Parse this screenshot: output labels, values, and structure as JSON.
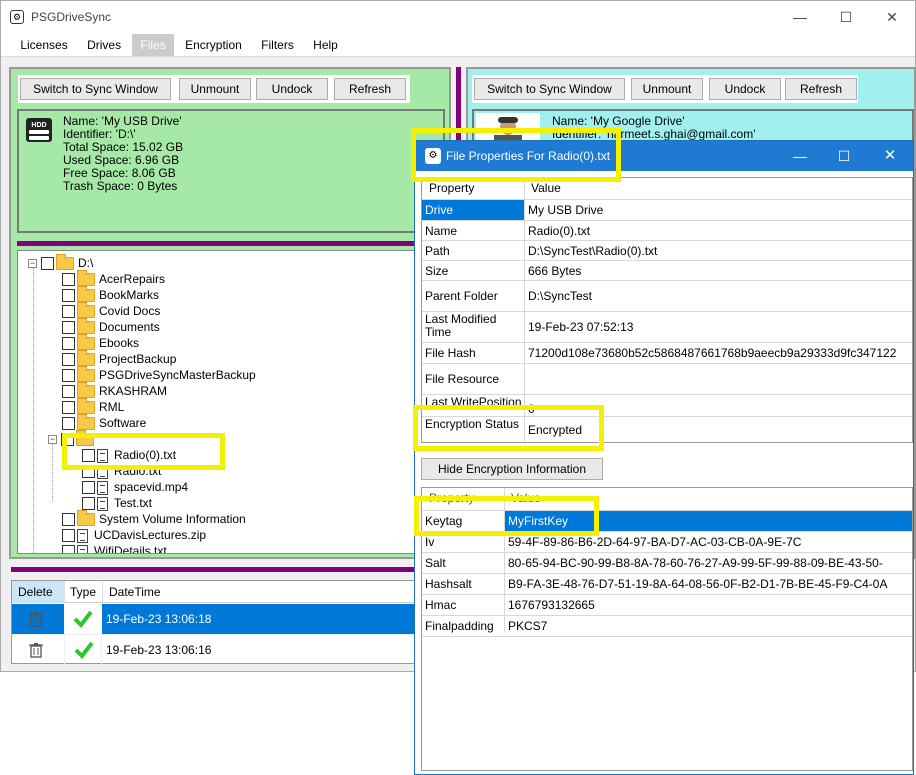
{
  "app": {
    "title": "PSGDriveSync",
    "menu": [
      "Licenses",
      "Drives",
      "Files",
      "Encryption",
      "Filters",
      "Help"
    ],
    "active_menu": "Files"
  },
  "left_panel": {
    "buttons": [
      "Switch to Sync Window",
      "Unmount",
      "Undock",
      "Refresh"
    ],
    "drive_icon_text": "HDD",
    "info": [
      "Name: 'My USB Drive'",
      "Identifier: 'D:\\'",
      "Total Space: 15.02 GB",
      "Used Space: 6.96 GB",
      "Free Space: 8.06 GB",
      "Trash Space: 0 Bytes"
    ],
    "tree": {
      "root": "D:\\",
      "items": [
        {
          "label": "AcerRepairs",
          "type": "folder"
        },
        {
          "label": "BookMarks",
          "type": "folder"
        },
        {
          "label": "Covid Docs",
          "type": "folder"
        },
        {
          "label": "Documents",
          "type": "folder"
        },
        {
          "label": "Ebooks",
          "type": "folder"
        },
        {
          "label": "ProjectBackup",
          "type": "folder"
        },
        {
          "label": "PSGDriveSyncMasterBackup",
          "type": "folder"
        },
        {
          "label": "RKASHRAM",
          "type": "folder"
        },
        {
          "label": "RML",
          "type": "folder"
        },
        {
          "label": "Software",
          "type": "folder"
        },
        {
          "label": "Radio(0).txt",
          "type": "file"
        },
        {
          "label": "Radio.txt",
          "type": "file"
        },
        {
          "label": "spacevid.mp4",
          "type": "file"
        },
        {
          "label": "Test.txt",
          "type": "file"
        },
        {
          "label": "System Volume Information",
          "type": "folder"
        },
        {
          "label": "UCDavisLectures.zip",
          "type": "file"
        },
        {
          "label": "WifiDetails.txt",
          "type": "file"
        }
      ]
    }
  },
  "right_panel": {
    "buttons": [
      "Switch to Sync Window",
      "Unmount",
      "Undock",
      "Refresh"
    ],
    "info": [
      "Name: 'My Google Drive'",
      "Identifier: 'harmeet.s.ghai@gmail.com'"
    ],
    "identifier_visible": "Identifier: 'harmeet.s.ghai@gmail.com'"
  },
  "trash_table": {
    "headers": [
      "Delete",
      "Type",
      "DateTime"
    ],
    "rows": [
      {
        "datetime": "19-Feb-23 13:06:18",
        "selected": true
      },
      {
        "datetime": "19-Feb-23 13:06:16",
        "selected": false
      }
    ]
  },
  "dialog": {
    "title": "File Properties For Radio(0).txt",
    "props_headers": [
      "Property",
      "Value"
    ],
    "props": [
      {
        "property": "Drive",
        "value": "My USB Drive"
      },
      {
        "property": "Name",
        "value": "Radio(0).txt"
      },
      {
        "property": "Path",
        "value": "D:\\SyncTest\\Radio(0).txt"
      },
      {
        "property": "Size",
        "value": "666 Bytes"
      },
      {
        "property": "Parent Folder",
        "value": "D:\\SyncTest"
      },
      {
        "property": "Last Modified Time",
        "value": "19-Feb-23 07:52:13"
      },
      {
        "property": "File Hash",
        "value": "71200d108e73680b52c5868487661768b9aeecb9a29333d9fc347122"
      },
      {
        "property": "File Resource",
        "value": ""
      },
      {
        "property": "Last WritePosition",
        "value": "0"
      },
      {
        "property": "Encryption Status",
        "value": "Encrypted"
      }
    ],
    "toggle_button": "Hide Encryption Information",
    "enc_headers": [
      "Property",
      "Value"
    ],
    "enc": [
      {
        "property": "Keytag",
        "value": "MyFirstKey"
      },
      {
        "property": "Iv",
        "value": "59-4F-89-86-B6-2D-64-97-BA-D7-AC-03-CB-0A-9E-7C"
      },
      {
        "property": "Salt",
        "value": "80-65-94-BC-90-99-B8-8A-78-60-76-27-A9-99-5F-99-88-09-BE-43-50-"
      },
      {
        "property": "Hashsalt",
        "value": "B9-FA-3E-48-76-D7-51-19-8A-64-08-56-0F-B2-D1-7B-BE-45-F9-C4-0A"
      },
      {
        "property": "Hmac",
        "value": "1676793132665"
      },
      {
        "property": "Finalpadding",
        "value": "PKCS7"
      }
    ]
  },
  "colors": {
    "highlight": "#f5f000",
    "selection": "#0078d7",
    "green_panel": "#a6e8a6",
    "cyan_panel": "#a0f0f0",
    "divider": "#800080"
  }
}
